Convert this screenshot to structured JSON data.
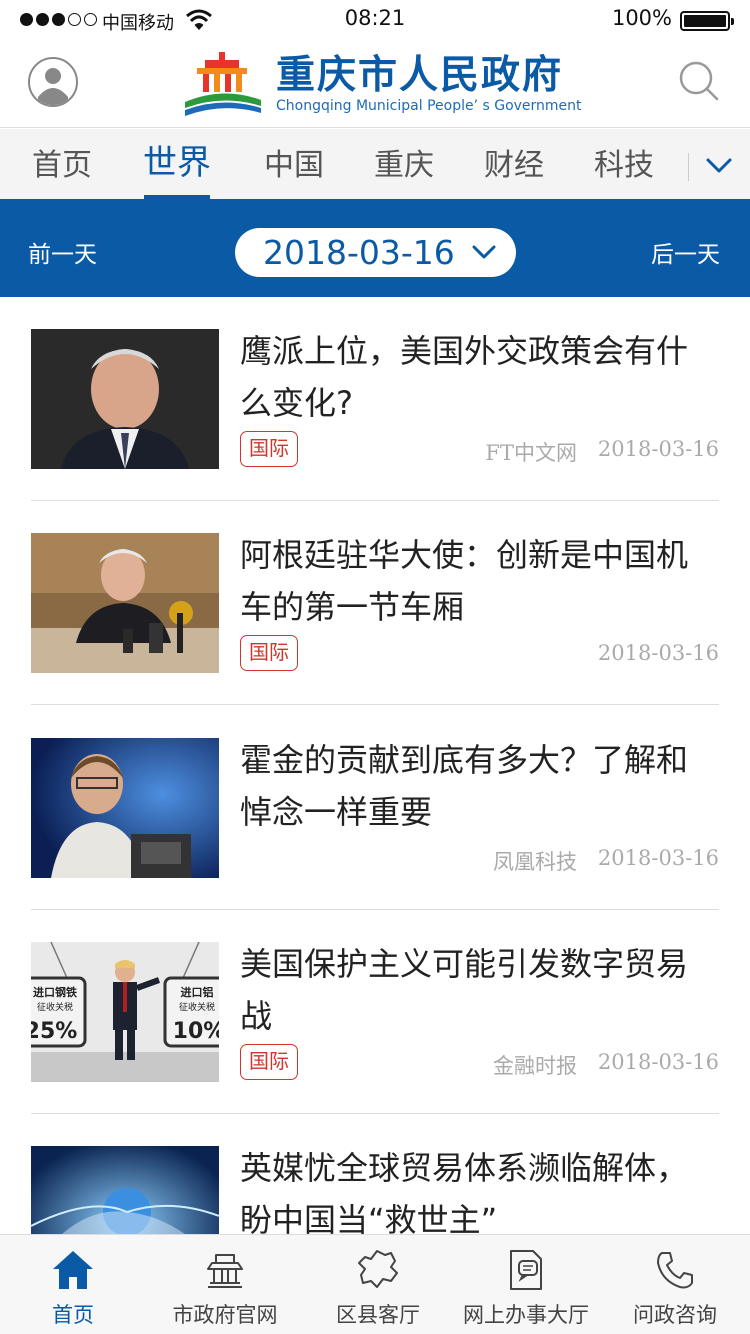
{
  "status_bar": {
    "carrier": "中国移动",
    "time": "08:21",
    "battery": "100%"
  },
  "header": {
    "title_cn": "重庆市人民政府",
    "title_en": "Chongqing Municipal People’ s Government"
  },
  "tabs": [
    {
      "label": "首页",
      "active": false
    },
    {
      "label": "世界",
      "active": true
    },
    {
      "label": "中国",
      "active": false
    },
    {
      "label": "重庆",
      "active": false
    },
    {
      "label": "财经",
      "active": false
    },
    {
      "label": "科技",
      "active": false
    }
  ],
  "date_bar": {
    "prev_label": "前一天",
    "date": "2018-03-16",
    "next_label": "后一天"
  },
  "news": [
    {
      "title": "鹰派上位，美国外交政策会有什么变化?",
      "tag": "国际",
      "source": "FT中文网",
      "date": "2018-03-16"
    },
    {
      "title": "阿根廷驻华大使：创新是中国机车的第一节车厢",
      "tag": "国际",
      "source": "",
      "date": "2018-03-16"
    },
    {
      "title": "霍金的贡献到底有多大？了解和悼念一样重要",
      "tag": "",
      "source": "凤凰科技",
      "date": "2018-03-16"
    },
    {
      "title": "美国保护主义可能引发数字贸易战",
      "tag": "国际",
      "source": "金融时报",
      "date": "2018-03-16"
    },
    {
      "title": "英媒忧全球贸易体系濒临解体，盼中国当“救世主”",
      "tag": "",
      "source": "",
      "date": ""
    }
  ],
  "thumb_text": {
    "left_sign_line1": "进口钢铁",
    "left_sign_line2": "征收关税",
    "left_sign_pct": "25%",
    "right_sign_line1": "进口铝",
    "right_sign_line2": "征收关税",
    "right_sign_pct": "10%"
  },
  "bottom_nav": [
    {
      "label": "首页",
      "icon": "home-icon",
      "active": true
    },
    {
      "label": "市政府官网",
      "icon": "government-building-icon",
      "active": false
    },
    {
      "label": "区县客厅",
      "icon": "district-map-icon",
      "active": false
    },
    {
      "label": "网上办事大厅",
      "icon": "document-service-icon",
      "active": false
    },
    {
      "label": "问政咨询",
      "icon": "phone-icon",
      "active": false
    }
  ],
  "colors": {
    "brand_blue": "#0a5aa6",
    "tag_red": "#d0342c",
    "meta_gray": "#aaaaaa"
  }
}
